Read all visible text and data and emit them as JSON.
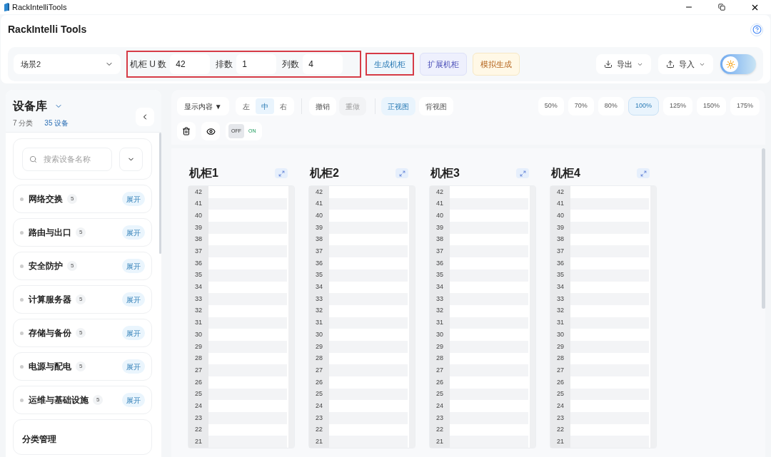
{
  "window": {
    "title": "RackIntelliTools"
  },
  "app_title": "RackIntelli Tools",
  "scene_select": {
    "value": "场景2"
  },
  "params": {
    "highlighted": true,
    "fields": [
      {
        "label": "机柜 U 数",
        "value": "42"
      },
      {
        "label": "排数",
        "value": "1"
      },
      {
        "label": "列数",
        "value": "4"
      }
    ]
  },
  "actions": [
    {
      "label": "生成机柜",
      "kind": "sky",
      "highlighted": true
    },
    {
      "label": "扩展机柜",
      "kind": "indigo",
      "highlighted": false
    },
    {
      "label": "模拟生成",
      "kind": "amber",
      "highlighted": false
    }
  ],
  "menus": [
    {
      "label": "导出",
      "kind": "export"
    },
    {
      "label": "导入",
      "kind": "import"
    }
  ],
  "theme": {
    "dark": false
  },
  "sidebar": {
    "title": "设备库",
    "category_count": "7 分类",
    "device_count": "35 设备",
    "search": {
      "placeholder": "搜索设备名称"
    },
    "categories": [
      {
        "name": "网络交换",
        "count": "5",
        "action": "展开"
      },
      {
        "name": "路由与出口",
        "count": "5",
        "action": "展开"
      },
      {
        "name": "安全防护",
        "count": "5",
        "action": "展开"
      },
      {
        "name": "计算服务器",
        "count": "5",
        "action": "展开"
      },
      {
        "name": "存储与备份",
        "count": "5",
        "action": "展开"
      },
      {
        "name": "电源与配电",
        "count": "5",
        "action": "展开"
      },
      {
        "name": "运维与基础设施",
        "count": "5",
        "action": "展开"
      }
    ],
    "section": "分类管理"
  },
  "toolbar": {
    "display_menu": "显示内容 ▼",
    "align": [
      {
        "label": "左",
        "selected": false
      },
      {
        "label": "中",
        "selected": true
      },
      {
        "label": "右",
        "selected": false
      }
    ],
    "history": [
      {
        "label": "撤销",
        "disabled": false
      },
      {
        "label": "重做",
        "disabled": true
      }
    ],
    "views": [
      {
        "label": "正视图",
        "selected": true
      },
      {
        "label": "背视图",
        "selected": false
      }
    ],
    "zoom": [
      {
        "label": "50%",
        "selected": false
      },
      {
        "label": "70%",
        "selected": false
      },
      {
        "label": "80%",
        "selected": false
      },
      {
        "label": "100%",
        "selected": true
      },
      {
        "label": "125%",
        "selected": false
      },
      {
        "label": "150%",
        "selected": false
      },
      {
        "label": "175%",
        "selected": false
      }
    ],
    "switch": {
      "off_label": "OFF",
      "on_label": "ON",
      "on": false
    }
  },
  "racks": [
    {
      "title": "机柜1",
      "units": [
        "42",
        "41",
        "40",
        "39",
        "38",
        "37",
        "36",
        "35",
        "34",
        "33",
        "32",
        "31",
        "30",
        "29",
        "28",
        "27",
        "26",
        "25",
        "24",
        "23",
        "22",
        "21"
      ]
    },
    {
      "title": "机柜2",
      "units": [
        "42",
        "41",
        "40",
        "39",
        "38",
        "37",
        "36",
        "35",
        "34",
        "33",
        "32",
        "31",
        "30",
        "29",
        "28",
        "27",
        "26",
        "25",
        "24",
        "23",
        "22",
        "21"
      ]
    },
    {
      "title": "机柜3",
      "units": [
        "42",
        "41",
        "40",
        "39",
        "38",
        "37",
        "36",
        "35",
        "34",
        "33",
        "32",
        "31",
        "30",
        "29",
        "28",
        "27",
        "26",
        "25",
        "24",
        "23",
        "22",
        "21"
      ]
    },
    {
      "title": "机柜4",
      "units": [
        "42",
        "41",
        "40",
        "39",
        "38",
        "37",
        "36",
        "35",
        "34",
        "33",
        "32",
        "31",
        "30",
        "29",
        "28",
        "27",
        "26",
        "25",
        "24",
        "23",
        "22",
        "21"
      ]
    }
  ]
}
